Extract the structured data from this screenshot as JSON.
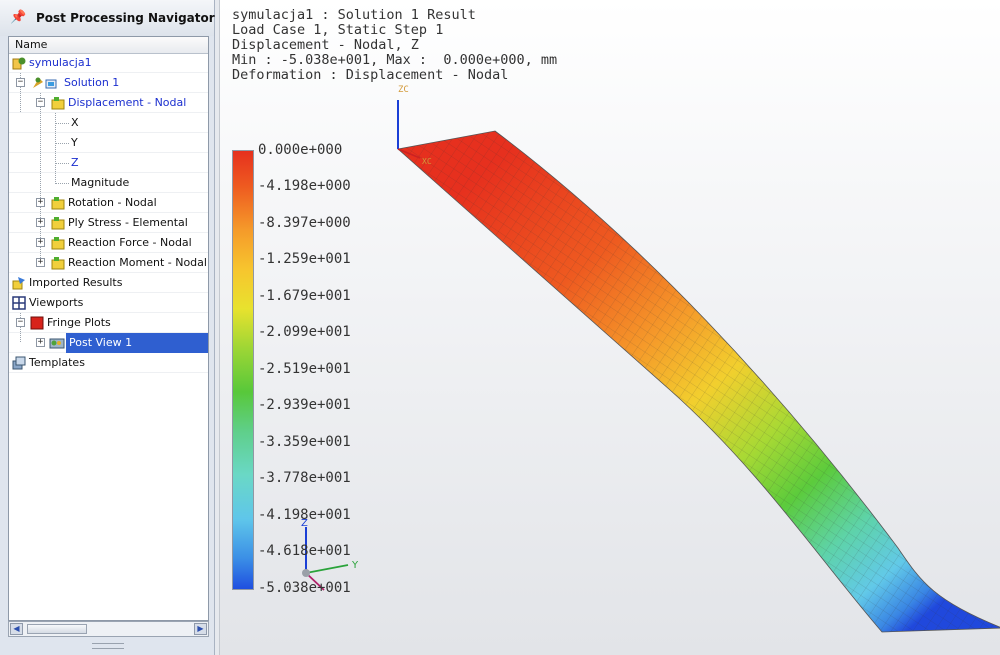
{
  "navigator": {
    "title": "Post Processing Navigator",
    "column_header": "Name",
    "tree": [
      {
        "label": "symulacja1",
        "color": "#1b2fcf"
      },
      {
        "label": "Solution 1",
        "color": "#1b2fcf"
      },
      {
        "label": "Displacement - Nodal",
        "color": "#1b2fcf"
      },
      {
        "label": "X",
        "color": "#111111"
      },
      {
        "label": "Y",
        "color": "#111111"
      },
      {
        "label": "Z",
        "color": "#1b2fcf"
      },
      {
        "label": "Magnitude",
        "color": "#111111"
      },
      {
        "label": "Rotation - Nodal",
        "color": "#111111"
      },
      {
        "label": "Ply Stress - Elemental",
        "color": "#111111"
      },
      {
        "label": "Reaction Force - Nodal",
        "color": "#111111"
      },
      {
        "label": "Reaction Moment - Nodal",
        "color": "#111111"
      },
      {
        "label": "Imported Results",
        "color": "#111111"
      },
      {
        "label": "Viewports",
        "color": "#111111"
      },
      {
        "label": "Fringe Plots",
        "color": "#111111"
      },
      {
        "label": "Post View 1",
        "color": "#ffffff",
        "selected": true
      },
      {
        "label": "Templates",
        "color": "#111111"
      }
    ]
  },
  "viewport": {
    "info_lines": [
      "symulacja1 : Solution 1 Result",
      "Load Case 1, Static Step 1",
      "Displacement - Nodal, Z",
      "Min : -5.038e+001, Max :  0.000e+000, mm",
      "Deformation : Displacement - Nodal"
    ],
    "legend_ticks": [
      "0.000e+000",
      "-4.198e+000",
      "-8.397e+000",
      "-1.259e+001",
      "-1.679e+001",
      "-2.099e+001",
      "-2.519e+001",
      "-2.939e+001",
      "-3.359e+001",
      "-3.778e+001",
      "-4.198e+001",
      "-4.618e+001",
      "-5.038e+001"
    ],
    "triad": {
      "z": "Z",
      "y": "Y"
    },
    "model_triad": {
      "z": "ZC",
      "x": "XC"
    }
  }
}
